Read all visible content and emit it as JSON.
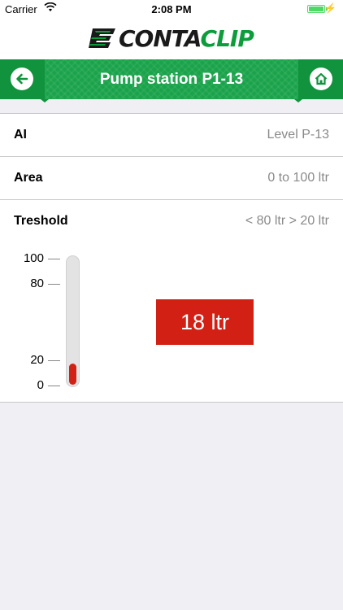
{
  "status": {
    "carrier": "Carrier",
    "time": "2:08 PM",
    "battery_level": 1.0
  },
  "brand": {
    "logo_part1": "CONTA",
    "logo_part2": "CLIP",
    "colors": {
      "green": "#0c9c3c",
      "dark": "#1a1a1a"
    }
  },
  "nav": {
    "title": "Pump station P1-13",
    "back_icon": "arrow-left-icon",
    "home_icon": "home-icon",
    "bar_color": "#1aa34a"
  },
  "rows": [
    {
      "label": "AI",
      "value": "Level P-13"
    },
    {
      "label": "Area",
      "value": "0 to 100 ltr"
    },
    {
      "label": "Treshold",
      "value": "< 80 ltr > 20 ltr"
    }
  ],
  "gauge": {
    "ticks": [
      "100",
      "80",
      "20",
      "0"
    ],
    "tick_values": [
      100,
      80,
      20,
      0
    ],
    "min": 0,
    "max": 100,
    "level": 18,
    "readout": "18 ltr",
    "alarm_color": "#d22114"
  }
}
